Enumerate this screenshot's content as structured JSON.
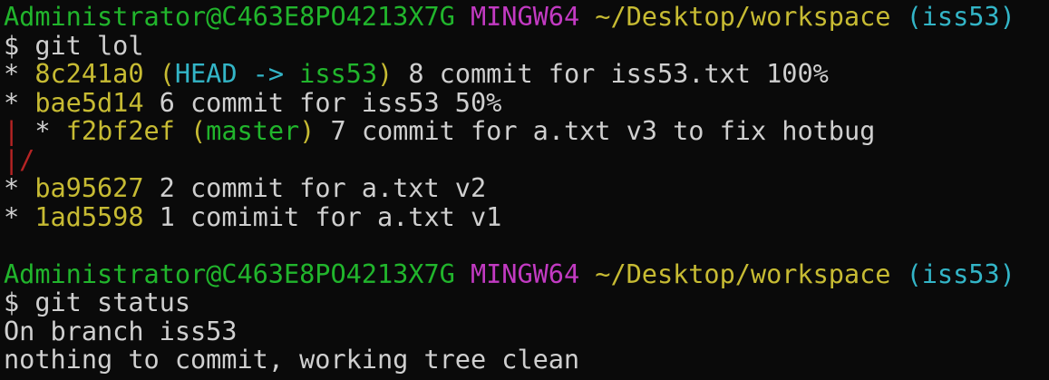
{
  "colors": {
    "background": "#0a0a0a",
    "green": "#21b52c",
    "magenta": "#c23ac2",
    "yellow": "#c7bb33",
    "cyan": "#33b5c7",
    "white": "#cfcfcf",
    "red": "#b52424"
  },
  "lines": [
    [
      {
        "t": "Administrator@C463E8PO4213X7G ",
        "c": "green"
      },
      {
        "t": "MINGW64 ",
        "c": "magenta"
      },
      {
        "t": "~/Desktop/workspace ",
        "c": "yellow"
      },
      {
        "t": "(iss53)",
        "c": "cyan"
      }
    ],
    [
      {
        "t": "$ git lol",
        "c": "white"
      }
    ],
    [
      {
        "t": "* ",
        "c": "white"
      },
      {
        "t": "8c241a0 (",
        "c": "yellow"
      },
      {
        "t": "HEAD -> ",
        "c": "cyan"
      },
      {
        "t": "iss53",
        "c": "green"
      },
      {
        "t": ")",
        "c": "yellow"
      },
      {
        "t": " 8 commit for iss53.txt 100%",
        "c": "white"
      }
    ],
    [
      {
        "t": "* ",
        "c": "white"
      },
      {
        "t": "bae5d14",
        "c": "yellow"
      },
      {
        "t": " 6 commit for iss53 50%",
        "c": "white"
      }
    ],
    [
      {
        "t": "| ",
        "c": "red"
      },
      {
        "t": "* ",
        "c": "white"
      },
      {
        "t": "f2bf2ef (",
        "c": "yellow"
      },
      {
        "t": "master",
        "c": "green"
      },
      {
        "t": ")",
        "c": "yellow"
      },
      {
        "t": " 7 commit for a.txt v3 to fix hotbug",
        "c": "white"
      }
    ],
    [
      {
        "t": "|/",
        "c": "red"
      }
    ],
    [
      {
        "t": "* ",
        "c": "white"
      },
      {
        "t": "ba95627",
        "c": "yellow"
      },
      {
        "t": " 2 commit for a.txt v2",
        "c": "white"
      }
    ],
    [
      {
        "t": "* ",
        "c": "white"
      },
      {
        "t": "1ad5598",
        "c": "yellow"
      },
      {
        "t": " 1 comimit for a.txt v1",
        "c": "white"
      }
    ],
    [],
    [
      {
        "t": "Administrator@C463E8PO4213X7G ",
        "c": "green"
      },
      {
        "t": "MINGW64 ",
        "c": "magenta"
      },
      {
        "t": "~/Desktop/workspace ",
        "c": "yellow"
      },
      {
        "t": "(iss53)",
        "c": "cyan"
      }
    ],
    [
      {
        "t": "$ git status",
        "c": "white"
      }
    ],
    [
      {
        "t": "On branch iss53",
        "c": "white"
      }
    ],
    [
      {
        "t": "nothing to commit, working tree clean",
        "c": "white"
      }
    ]
  ]
}
